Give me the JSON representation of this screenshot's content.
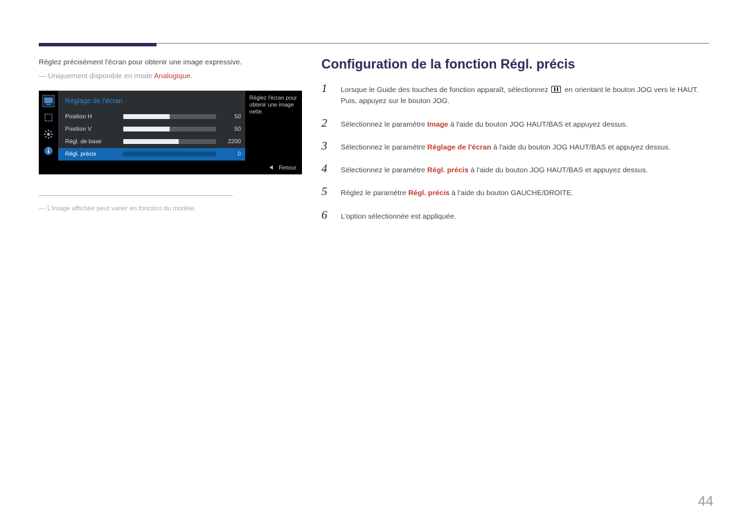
{
  "page_number": "44",
  "left": {
    "intro": "Réglez précisément l'écran pour obtenir une image expressive.",
    "note_prefix": "― Uniquement disponible en mode ",
    "note_mode": "Analogique",
    "note_suffix": ".",
    "footnote": "― L'image affichée peut varier en fonction du modèle."
  },
  "osd": {
    "title": "Réglage de l'écran",
    "help_text": "Réglez l'écran pour obtenir une image nette.",
    "rows": [
      {
        "label": "Position H",
        "value": "50",
        "fill_pct": 50,
        "selected": false
      },
      {
        "label": "Position V",
        "value": "50",
        "fill_pct": 50,
        "selected": false
      },
      {
        "label": "Régl. de base",
        "value": "2200",
        "fill_pct": 60,
        "selected": false
      },
      {
        "label": "Régl. précis",
        "value": "0",
        "fill_pct": 0,
        "selected": true
      }
    ],
    "footer_label": "Retour",
    "sidebar_icons": [
      "monitor-icon",
      "resize-icon",
      "gear-icon",
      "info-icon"
    ]
  },
  "right": {
    "heading": "Configuration de la fonction Régl. précis",
    "steps": [
      {
        "num": "1",
        "pre": "Lorsque le Guide des touches de fonction apparaît, sélectionnez ",
        "post": " en orientant le bouton JOG vers le HAUT. Puis, appuyez sur le bouton JOG.",
        "has_icon": true
      },
      {
        "num": "2",
        "pre": "Sélectionnez le paramètre ",
        "bold": "Image",
        "bold_red": true,
        "post": " à l'aide du bouton JOG HAUT/BAS et appuyez dessus."
      },
      {
        "num": "3",
        "pre": "Sélectionnez le paramètre ",
        "bold": "Réglage de l'écran",
        "bold_red": true,
        "post": " à l'aide du bouton JOG HAUT/BAS et appuyez dessus."
      },
      {
        "num": "4",
        "pre": "Sélectionnez le paramètre ",
        "bold": "Régl. précis",
        "bold_red": true,
        "post": " à l'aide du bouton JOG HAUT/BAS et appuyez dessus."
      },
      {
        "num": "5",
        "pre": "Réglez le paramètre ",
        "bold": "Régl. précis",
        "bold_red": true,
        "post": " à l'aide du bouton GAUCHE/DROITE."
      },
      {
        "num": "6",
        "pre": "L'option sélectionnée est appliquée.",
        "post": ""
      }
    ]
  }
}
